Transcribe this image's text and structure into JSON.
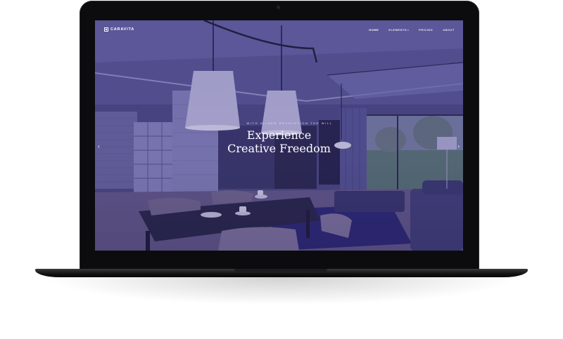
{
  "site": {
    "logo_text": "CARAVITA"
  },
  "nav": {
    "items": [
      {
        "label": "HOME",
        "active": true
      },
      {
        "label": "ELEMENTS",
        "dropdown": true
      },
      {
        "label": "PRICING"
      },
      {
        "label": "ABOUT"
      }
    ],
    "dropdown_caret": "▾"
  },
  "hero": {
    "kicker": "WITH SLIDER REVOLUTION THE WILL",
    "title_line1": "Experience",
    "title_line2": "Creative Freedom"
  },
  "slider": {
    "prev_glyph": "‹",
    "next_glyph": "›"
  },
  "colors": {
    "overlay": "#6c6aa6",
    "chassis": "#0c0c0e",
    "text": "#ffffff"
  }
}
